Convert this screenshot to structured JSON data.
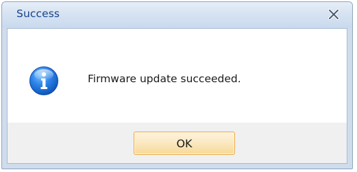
{
  "dialog": {
    "title": "Success",
    "message": "Firmware update succeeded.",
    "icon": "info-icon",
    "close_icon": "close-icon",
    "ok_label": "OK"
  },
  "colors": {
    "title_text": "#15428b",
    "frame": "#cfdcec",
    "ok_border": "#eca93e",
    "icon_blue": "#1e6fd9"
  }
}
